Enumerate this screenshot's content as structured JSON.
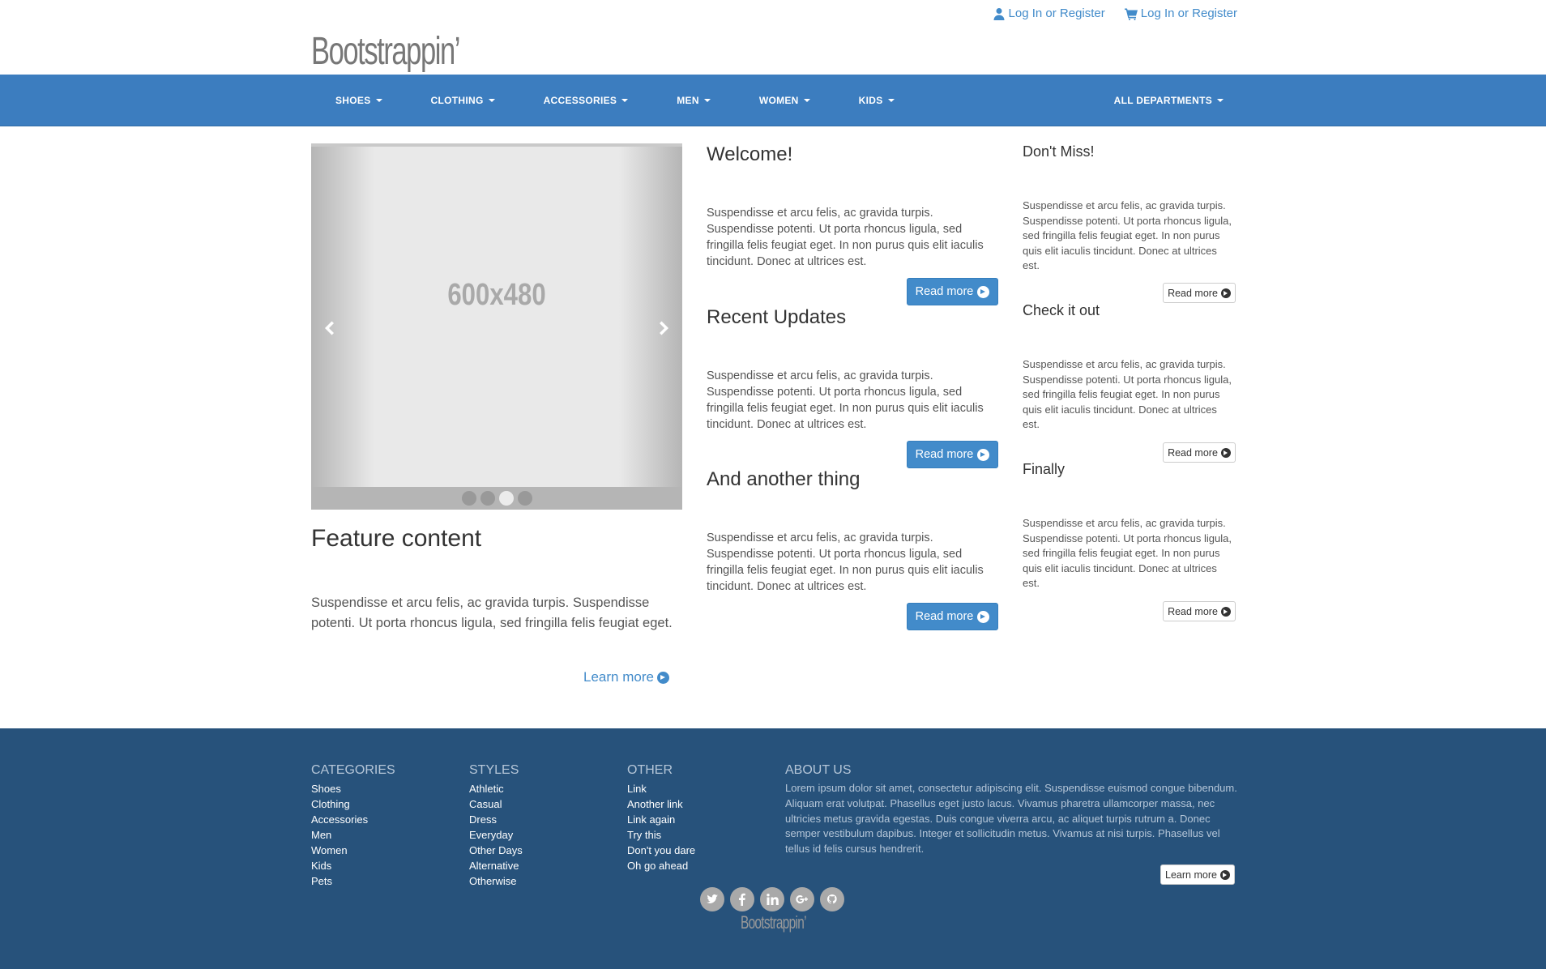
{
  "header": {
    "logo": "Bootstrappin’",
    "links": [
      {
        "label": "Log In or Register",
        "icon": "user-icon"
      },
      {
        "label": "Log In or Register",
        "icon": "cart-icon"
      }
    ]
  },
  "nav": {
    "items": [
      "SHOES",
      "CLOTHING",
      "ACCESSORIES",
      "MEN",
      "WOMEN",
      "KIDS"
    ],
    "right": "ALL DEPARTMENTS"
  },
  "carousel": {
    "placeholder": "600x480",
    "slide_count": 4,
    "active_index": 2
  },
  "feature": {
    "title": "Feature content",
    "text": "Suspendisse et arcu felis, ac gravida turpis. Suspendisse potenti. Ut porta rhoncus ligula, sed fringilla felis feugiat eget.",
    "link": "Learn more"
  },
  "middle": [
    {
      "title": "Welcome!",
      "text": "Suspendisse et arcu felis, ac gravida turpis. Suspendisse potenti. Ut porta rhoncus ligula, sed fringilla felis feugiat eget. In non purus quis elit iaculis tincidunt. Donec at ultrices est.",
      "button": "Read more"
    },
    {
      "title": "Recent Updates",
      "text": "Suspendisse et arcu felis, ac gravida turpis. Suspendisse potenti. Ut porta rhoncus ligula, sed fringilla felis feugiat eget. In non purus quis elit iaculis tincidunt. Donec at ultrices est.",
      "button": "Read more"
    },
    {
      "title": "And another thing",
      "text": "Suspendisse et arcu felis, ac gravida turpis. Suspendisse potenti. Ut porta rhoncus ligula, sed fringilla felis feugiat eget. In non purus quis elit iaculis tincidunt. Donec at ultrices est.",
      "button": "Read more"
    }
  ],
  "side": [
    {
      "title": "Don't Miss!",
      "text": "Suspendisse et arcu felis, ac gravida turpis. Suspendisse potenti. Ut porta rhoncus ligula, sed fringilla felis feugiat eget. In non purus quis elit iaculis tincidunt. Donec at ultrices est.",
      "button": "Read more"
    },
    {
      "title": "Check it out",
      "text": "Suspendisse et arcu felis, ac gravida turpis. Suspendisse potenti. Ut porta rhoncus ligula, sed fringilla felis feugiat eget. In non purus quis elit iaculis tincidunt. Donec at ultrices est.",
      "button": "Read more"
    },
    {
      "title": "Finally",
      "text": "Suspendisse et arcu felis, ac gravida turpis. Suspendisse potenti. Ut porta rhoncus ligula, sed fringilla felis feugiat eget. In non purus quis elit iaculis tincidunt. Donec at ultrices est.",
      "button": "Read more"
    }
  ],
  "footer": {
    "categories": {
      "title": "CATEGORIES",
      "items": [
        "Shoes",
        "Clothing",
        "Accessories",
        "Men",
        "Women",
        "Kids",
        "Pets"
      ]
    },
    "styles": {
      "title": "STYLES",
      "items": [
        "Athletic",
        "Casual",
        "Dress",
        "Everyday",
        "Other Days",
        "Alternative",
        "Otherwise"
      ]
    },
    "other": {
      "title": "OTHER",
      "items": [
        "Link",
        "Another link",
        "Link again",
        "Try this",
        "Don't you dare",
        "Oh go ahead"
      ]
    },
    "about": {
      "title": "ABOUT US",
      "text": "Lorem ipsum dolor sit amet, consectetur adipiscing elit. Suspendisse euismod congue bibendum. Aliquam erat volutpat. Phasellus eget justo lacus. Vivamus pharetra ullamcorper massa, nec ultricies metus gravida egestas. Duis congue viverra arcu, ac aliquet turpis rutrum a. Donec semper vestibulum dapibus. Integer et sollicitudin metus. Vivamus at nisi turpis. Phasellus vel tellus id felis cursus hendrerit.",
      "button": "Learn more"
    },
    "social": [
      "twitter-icon",
      "facebook-icon",
      "linkedin-icon",
      "google-plus-icon",
      "github-icon"
    ],
    "logo": "Bootstrappin’"
  },
  "colors": {
    "brand": "#428bca",
    "navbar": "#3c7dbf",
    "footer": "#27527b"
  }
}
